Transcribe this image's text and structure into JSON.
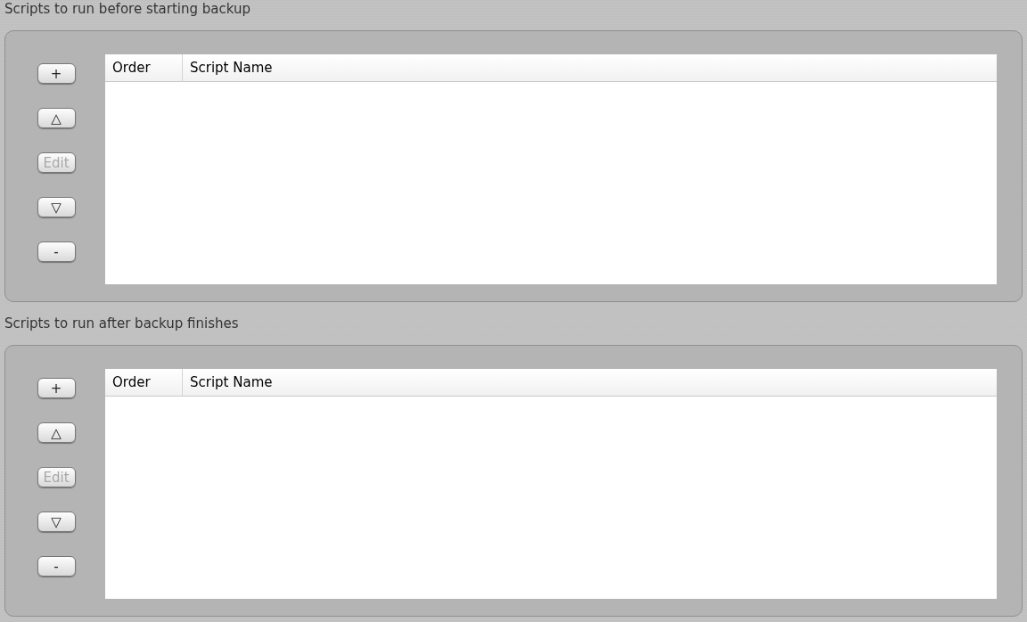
{
  "sections": [
    {
      "title": "Scripts to run before starting backup",
      "buttons": [
        {
          "label": "+",
          "disabled": false
        },
        {
          "label": "△",
          "disabled": false
        },
        {
          "label": "Edit",
          "disabled": true
        },
        {
          "label": "▽",
          "disabled": false
        },
        {
          "label": "-",
          "disabled": false
        }
      ],
      "table": {
        "columns": [
          "Order",
          "Script Name"
        ]
      }
    },
    {
      "title": "Scripts to run after backup finishes",
      "buttons": [
        {
          "label": "+",
          "disabled": false
        },
        {
          "label": "△",
          "disabled": false
        },
        {
          "label": "Edit",
          "disabled": true
        },
        {
          "label": "▽",
          "disabled": false
        },
        {
          "label": "-",
          "disabled": false
        }
      ],
      "table": {
        "columns": [
          "Order",
          "Script Name"
        ]
      }
    }
  ]
}
